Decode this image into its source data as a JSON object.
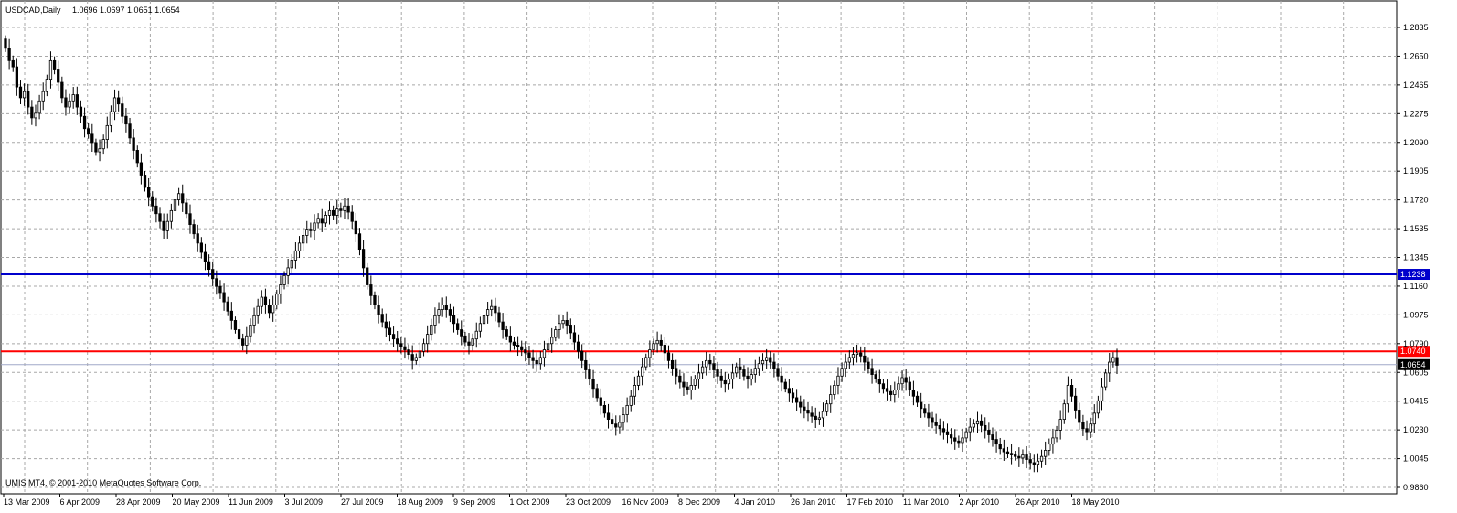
{
  "header": {
    "symbol": "USDCAD,Daily",
    "ohlc": "1.0696 1.0697 1.0651 1.0654"
  },
  "footer": {
    "copyright": "UMIS MT4, © 2001-2010 MetaQuotes Software Corp."
  },
  "colors": {
    "background": "#ffffff",
    "grid": "#a8a8a8",
    "candle": "#000000",
    "bull_body": "#ffffff",
    "resistance_line": "#0000cc",
    "support_line": "#ff0000",
    "bid_line": "#a0a8c8"
  },
  "chart_data": {
    "type": "candlestick",
    "symbol": "USDCAD",
    "timeframe": "Daily",
    "x_tick_labels": [
      "13 Mar 2009",
      "6 Apr 2009",
      "28 Apr 2009",
      "20 May 2009",
      "11 Jun 2009",
      "3 Jul 2009",
      "27 Jul 2009",
      "18 Aug 2009",
      "9 Sep 2009",
      "1 Oct 2009",
      "23 Oct 2009",
      "16 Nov 2009",
      "8 Dec 2009",
      "4 Jan 2010",
      "26 Jan 2010",
      "17 Feb 2010",
      "11 Mar 2010",
      "2 Apr 2010",
      "26 Apr 2010",
      "18 May 2010"
    ],
    "y_tick_labels": [
      "1.2835",
      "1.2650",
      "1.2465",
      "1.2275",
      "1.2090",
      "1.1905",
      "1.1720",
      "1.1535",
      "1.1345",
      "1.1160",
      "1.0975",
      "1.0790",
      "1.0605",
      "1.0415",
      "1.0230",
      "1.0045",
      "0.9860"
    ],
    "ylim": [
      0.986,
      1.2835
    ],
    "grid": true,
    "horizontal_lines": [
      {
        "label": "1.1238",
        "value": 1.1238,
        "color": "#0000cc"
      },
      {
        "label": "1.0740",
        "value": 1.074,
        "color": "#ff0000"
      },
      {
        "label": "1.0654",
        "value": 1.0654,
        "color": "#a0a8c8"
      }
    ],
    "last_close": 1.0654,
    "closes": [
      1.27,
      1.262,
      1.258,
      1.245,
      1.238,
      1.242,
      1.232,
      1.225,
      1.228,
      1.236,
      1.242,
      1.25,
      1.262,
      1.256,
      1.248,
      1.238,
      1.232,
      1.236,
      1.24,
      1.232,
      1.226,
      1.218,
      1.215,
      1.209,
      1.203,
      1.205,
      1.211,
      1.22,
      1.229,
      1.238,
      1.234,
      1.226,
      1.221,
      1.212,
      1.204,
      1.196,
      1.188,
      1.18,
      1.174,
      1.168,
      1.163,
      1.158,
      1.152,
      1.158,
      1.165,
      1.172,
      1.176,
      1.17,
      1.163,
      1.156,
      1.15,
      1.144,
      1.138,
      1.132,
      1.127,
      1.121,
      1.116,
      1.112,
      1.106,
      1.1,
      1.094,
      1.088,
      1.082,
      1.078,
      1.084,
      1.091,
      1.097,
      1.103,
      1.109,
      1.104,
      1.099,
      1.104,
      1.111,
      1.117,
      1.123,
      1.128,
      1.133,
      1.139,
      1.144,
      1.149,
      1.153,
      1.152,
      1.157,
      1.16,
      1.157,
      1.162,
      1.165,
      1.162,
      1.166,
      1.165,
      1.168,
      1.164,
      1.158,
      1.15,
      1.14,
      1.128,
      1.117,
      1.11,
      1.104,
      1.098,
      1.093,
      1.089,
      1.085,
      1.082,
      1.079,
      1.077,
      1.075,
      1.072,
      1.068,
      1.07,
      1.074,
      1.079,
      1.085,
      1.091,
      1.097,
      1.101,
      1.104,
      1.101,
      1.097,
      1.092,
      1.088,
      1.084,
      1.08,
      1.078,
      1.082,
      1.087,
      1.092,
      1.097,
      1.101,
      1.103,
      1.099,
      1.093,
      1.088,
      1.084,
      1.08,
      1.078,
      1.077,
      1.075,
      1.073,
      1.07,
      1.068,
      1.066,
      1.07,
      1.075,
      1.079,
      1.083,
      1.088,
      1.092,
      1.094,
      1.091,
      1.086,
      1.08,
      1.074,
      1.068,
      1.062,
      1.056,
      1.05,
      1.044,
      1.039,
      1.034,
      1.03,
      1.027,
      1.025,
      1.028,
      1.033,
      1.039,
      1.045,
      1.052,
      1.058,
      1.064,
      1.07,
      1.075,
      1.079,
      1.081,
      1.078,
      1.073,
      1.068,
      1.063,
      1.058,
      1.054,
      1.051,
      1.049,
      1.052,
      1.056,
      1.06,
      1.064,
      1.068,
      1.066,
      1.062,
      1.058,
      1.055,
      1.053,
      1.056,
      1.06,
      1.064,
      1.062,
      1.058,
      1.056,
      1.059,
      1.063,
      1.066,
      1.068,
      1.07,
      1.067,
      1.063,
      1.058,
      1.054,
      1.05,
      1.047,
      1.044,
      1.041,
      1.038,
      1.036,
      1.034,
      1.032,
      1.03,
      1.031,
      1.035,
      1.04,
      1.046,
      1.052,
      1.058,
      1.063,
      1.067,
      1.07,
      1.072,
      1.073,
      1.071,
      1.067,
      1.063,
      1.059,
      1.056,
      1.053,
      1.05,
      1.048,
      1.046,
      1.049,
      1.053,
      1.057,
      1.054,
      1.049,
      1.045,
      1.041,
      1.037,
      1.034,
      1.031,
      1.028,
      1.026,
      1.024,
      1.022,
      1.02,
      1.018,
      1.016,
      1.015,
      1.018,
      1.022,
      1.025,
      1.027,
      1.029,
      1.026,
      1.023,
      1.02,
      1.017,
      1.014,
      1.011,
      1.009,
      1.008,
      1.007,
      1.006,
      1.005,
      1.007,
      1.004,
      1.002,
      1.001,
      1.003,
      1.006,
      1.01,
      1.014,
      1.018,
      1.023,
      1.03,
      1.04,
      1.052,
      1.045,
      1.036,
      1.028,
      1.024,
      1.022,
      1.027,
      1.034,
      1.042,
      1.051,
      1.06,
      1.067,
      1.07,
      1.065
    ]
  }
}
